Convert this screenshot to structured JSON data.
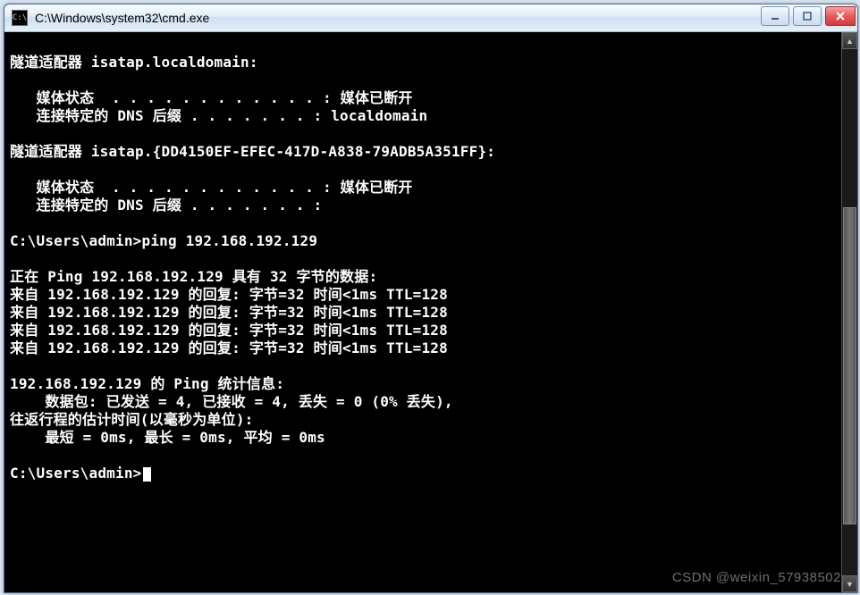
{
  "window": {
    "icon_label": "C:\\",
    "title": "C:\\Windows\\system32\\cmd.exe"
  },
  "console": {
    "lines": [
      "",
      "隧道适配器 isatap.localdomain:",
      "",
      "   媒体状态  . . . . . . . . . . . . : 媒体已断开",
      "   连接特定的 DNS 后缀 . . . . . . . : localdomain",
      "",
      "隧道适配器 isatap.{DD4150EF-EFEC-417D-A838-79ADB5A351FF}:",
      "",
      "   媒体状态  . . . . . . . . . . . . : 媒体已断开",
      "   连接特定的 DNS 后缀 . . . . . . . :",
      "",
      "C:\\Users\\admin>ping 192.168.192.129",
      "",
      "正在 Ping 192.168.192.129 具有 32 字节的数据:",
      "来自 192.168.192.129 的回复: 字节=32 时间<1ms TTL=128",
      "来自 192.168.192.129 的回复: 字节=32 时间<1ms TTL=128",
      "来自 192.168.192.129 的回复: 字节=32 时间<1ms TTL=128",
      "来自 192.168.192.129 的回复: 字节=32 时间<1ms TTL=128",
      "",
      "192.168.192.129 的 Ping 统计信息:",
      "    数据包: 已发送 = 4, 已接收 = 4, 丢失 = 0 (0% 丢失),",
      "往返行程的估计时间(以毫秒为单位):",
      "    最短 = 0ms, 最长 = 0ms, 平均 = 0ms",
      "",
      "C:\\Users\\admin>"
    ],
    "prompt_has_cursor_on_last": true
  },
  "watermark": "CSDN @weixin_57938502"
}
